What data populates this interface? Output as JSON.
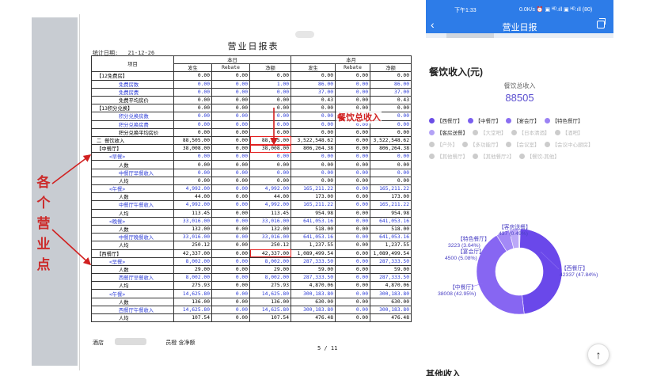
{
  "left_annotation": {
    "text": "各个营业点",
    "chars": [
      "各",
      "个",
      "营",
      "业",
      "点"
    ]
  },
  "document": {
    "title": "营业日报表",
    "stat_date_label": "统计日期:",
    "stat_date_value": "21-12-26",
    "header": {
      "item": "项目",
      "today": "本日",
      "month": "本月",
      "occur": "发生",
      "rebate": "Rebate",
      "net": "净额"
    },
    "rows": [
      [
        "【12免费房】",
        "0.00",
        "0.00",
        "0.00",
        "0.00",
        "0.00",
        "0.00"
      ],
      [
        "免费房数",
        "0.00",
        "0.00",
        "1.00",
        "86.00",
        "0.00",
        "86.00"
      ],
      [
        "免费房费",
        "0.00",
        "0.00",
        "0.00",
        "37.00",
        "0.00",
        "37.00"
      ],
      [
        "免费平均房价",
        "0.00",
        "0.00",
        "0.00",
        "0.43",
        "0.00",
        "0.43"
      ],
      [
        "【13积分兑换】",
        "0.00",
        "0.00",
        "0.00",
        "0.00",
        "0.00",
        "0.00"
      ],
      [
        "积分兑换房数",
        "0.00",
        "0.00",
        "0.00",
        "0.00",
        "0.00",
        "0.00"
      ],
      [
        "积分兑换房费",
        "0.00",
        "0.00",
        "0.00",
        "0.00",
        "0.00",
        "0.00"
      ],
      [
        "积分兑换平均房价",
        "0.00",
        "0.00",
        "0.00",
        "0.00",
        "0.00",
        "0.00"
      ],
      [
        "二 餐饮收入",
        "88,505.00",
        "0.00",
        "88,505.00",
        "3,522,548.62",
        "0.00",
        "3,522,548.62"
      ],
      [
        "【中餐厅】",
        "38,008.00",
        "0.00",
        "38,008.00",
        "806,264.38",
        "0.00",
        "806,264.38"
      ],
      [
        "<早餐>",
        "0.00",
        "0.00",
        "0.00",
        "0.00",
        "0.00",
        "0.00"
      ],
      [
        "人数",
        "0.00",
        "0.00",
        "0.00",
        "0.00",
        "0.00",
        "0.00"
      ],
      [
        "中餐厅早餐收入",
        "0.00",
        "0.00",
        "0.00",
        "0.00",
        "0.00",
        "0.00"
      ],
      [
        "人均",
        "0.00",
        "0.00",
        "0.00",
        "0.00",
        "0.00",
        "0.00"
      ],
      [
        "<午餐>",
        "4,992.00",
        "0.00",
        "4,992.00",
        "165,211.22",
        "0.00",
        "165,211.22"
      ],
      [
        "人数",
        "44.00",
        "0.00",
        "44.00",
        "173.00",
        "0.00",
        "173.00"
      ],
      [
        "中餐厅午餐收入",
        "4,992.00",
        "0.00",
        "4,992.00",
        "165,211.22",
        "0.00",
        "165,211.22"
      ],
      [
        "人均",
        "113.45",
        "0.00",
        "113.45",
        "954.98",
        "0.00",
        "954.98"
      ],
      [
        "<晚餐>",
        "33,016.00",
        "0.00",
        "33,016.00",
        "641,053.16",
        "0.00",
        "641,053.16"
      ],
      [
        "人数",
        "132.00",
        "0.00",
        "132.00",
        "518.00",
        "0.00",
        "518.00"
      ],
      [
        "中餐厅晚餐收入",
        "33,016.00",
        "0.00",
        "33,016.00",
        "641,053.16",
        "0.00",
        "641,053.16"
      ],
      [
        "人均",
        "250.12",
        "0.00",
        "250.12",
        "1,237.55",
        "0.00",
        "1,237.55"
      ],
      [
        "【西餐厅】",
        "42,337.00",
        "0.00",
        "42,337.00",
        "1,089,499.54",
        "0.00",
        "1,089,499.54"
      ],
      [
        "<早餐>",
        "8,002.00",
        "0.00",
        "8,002.00",
        "287,333.50",
        "0.00",
        "287,333.50"
      ],
      [
        "人数",
        "29.00",
        "0.00",
        "29.00",
        "59.00",
        "0.00",
        "59.00"
      ],
      [
        "西餐厅早餐收入",
        "8,002.00",
        "0.00",
        "8,002.00",
        "287,333.50",
        "0.00",
        "287,333.50"
      ],
      [
        "人均",
        "275.93",
        "0.00",
        "275.93",
        "4,870.06",
        "0.00",
        "4,870.06"
      ],
      [
        "<午餐>",
        "14,625.80",
        "0.00",
        "14,625.80",
        "300,183.80",
        "0.00",
        "300,183.80"
      ],
      [
        "人数",
        "136.00",
        "0.00",
        "136.00",
        "630.00",
        "0.00",
        "630.00"
      ],
      [
        "西餐厅午餐收入",
        "14,625.80",
        "0.00",
        "14,625.80",
        "300,183.80",
        "0.00",
        "300,183.80"
      ],
      [
        "人均",
        "107.54",
        "0.00",
        "107.54",
        "476.48",
        "0.00",
        "476.48"
      ]
    ],
    "callout": "餐饮总收入",
    "footer_left": "酒店",
    "footer_right": "员橙 含净额",
    "page_number": "5 / 11"
  },
  "phone": {
    "status_time": "下午1:33",
    "status_right": "0.0K/s ⏰ ▣ ᴴᴰ.ıll ▣ ᴴᴰ.ıll (80)",
    "nav_title": "营业日报",
    "section_title": "餐饮收入(元)",
    "total_label": "餐饮总收入",
    "total_value": "88505",
    "legend": [
      {
        "name": "【西餐厅】",
        "color": "#6b4ee6",
        "active": true
      },
      {
        "name": "【中餐厅】",
        "color": "#7a5ff0",
        "active": true
      },
      {
        "name": "【宴会厅】",
        "color": "#8a6ef2",
        "active": true
      },
      {
        "name": "【特色餐厅】",
        "color": "#9b82f4",
        "active": true
      },
      {
        "name": "【客房送餐】",
        "color": "#b3a2f6",
        "active": true
      },
      {
        "name": "【大堂吧】",
        "color": "#cccccc",
        "active": false
      },
      {
        "name": "【日本清酒】",
        "color": "#cccccc",
        "active": false
      },
      {
        "name": "【酒吧】",
        "color": "#cccccc",
        "active": false
      },
      {
        "name": "【户外】",
        "color": "#cccccc",
        "active": false
      },
      {
        "name": "【多功能厅】",
        "color": "#cccccc",
        "active": false
      },
      {
        "name": "【会议室】",
        "color": "#cccccc",
        "active": false
      },
      {
        "name": "【会议中心厨房】",
        "color": "#cccccc",
        "active": false
      },
      {
        "name": "【其他餐厅】",
        "color": "#cccccc",
        "active": false
      },
      {
        "name": "【其他餐厅2】",
        "color": "#cccccc",
        "active": false
      },
      {
        "name": "【餐饮-其他】",
        "color": "#cccccc",
        "active": false
      }
    ],
    "donut_labels": {
      "west_name": "【西餐厅】",
      "west_value": "42337 (47.84%)",
      "china_name": "【中餐厅】",
      "china_value": "38008 (42.95%)",
      "banquet_name": "【宴会厅】",
      "banquet_value": "4500 (5.08%)",
      "special_name": "【特色餐厅】",
      "special_value": "3223 (3.64%)",
      "room_name": "【客房送餐】",
      "room_value": "437 (0.49%)"
    },
    "bottom_peek": "其他收入",
    "scroll_top_icon": "↑"
  },
  "chart_data": {
    "type": "pie",
    "categories": [
      "【西餐厅】",
      "【中餐厅】",
      "【宴会厅】",
      "【特色餐厅】",
      "【客房送餐】"
    ],
    "values": [
      42337,
      38008,
      4500,
      3223,
      437
    ],
    "percent": [
      47.84,
      42.95,
      5.08,
      3.64,
      0.49
    ],
    "colors": [
      "#6a48ea",
      "#8766f2",
      "#a389f6",
      "#bba8f8",
      "#d3c7fb"
    ],
    "title": "餐饮收入(元)",
    "legend_position": "top"
  }
}
